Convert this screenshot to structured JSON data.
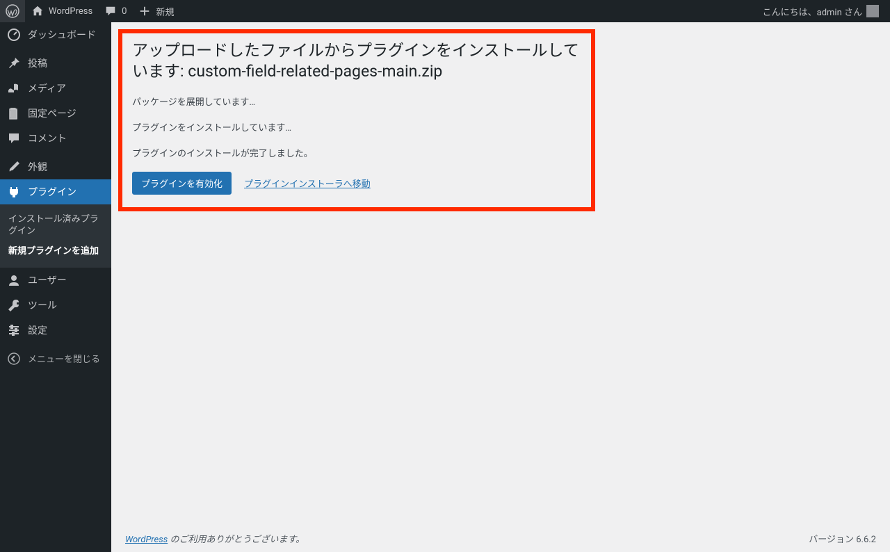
{
  "topbar": {
    "site_name": "WordPress",
    "comments_count": "0",
    "new_label": "新規",
    "greeting": "こんにちは、admin さん"
  },
  "sidebar": {
    "dashboard": "ダッシュボード",
    "posts": "投稿",
    "media": "メディア",
    "pages": "固定ページ",
    "comments": "コメント",
    "appearance": "外観",
    "plugins": "プラグイン",
    "plugins_sub_installed": "インストール済みプラグイン",
    "plugins_sub_add": "新規プラグインを追加",
    "users": "ユーザー",
    "tools": "ツール",
    "settings": "設定",
    "collapse": "メニューを閉じる"
  },
  "main": {
    "heading": "アップロードしたファイルからプラグインをインストールしています: custom-field-related-pages-main.zip",
    "status1": "パッケージを展開しています…",
    "status2": "プラグインをインストールしています…",
    "status3": "プラグインのインストールが完了しました。",
    "activate_button": "プラグインを有効化",
    "return_link": "プラグインインストーラへ移動"
  },
  "footer": {
    "wp_link": "WordPress",
    "thanks": " のご利用ありがとうございます。",
    "version": "バージョン 6.6.2"
  }
}
